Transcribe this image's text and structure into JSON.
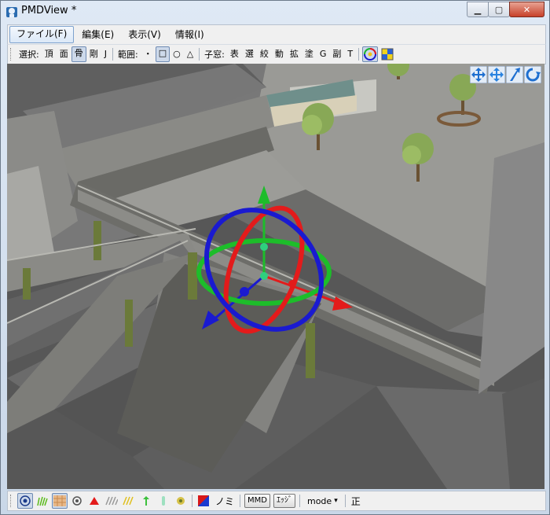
{
  "window": {
    "title": "PMDView *"
  },
  "menu": {
    "items": [
      "ファイル(F)",
      "編集(E)",
      "表示(V)",
      "情報(I)"
    ]
  },
  "toolbar": {
    "select_label": "選択:",
    "select_buttons": [
      "頂",
      "面",
      "骨",
      "剛",
      "J"
    ],
    "range_label": "範囲:",
    "range_buttons": [
      "・",
      "□",
      "○",
      "△"
    ],
    "child_label": "子窓:",
    "child_buttons": [
      "表",
      "選",
      "絞",
      "動",
      "拡",
      "塗",
      "G",
      "副",
      "T"
    ]
  },
  "viewport": {
    "controls": [
      "move-view-icon",
      "move-icon",
      "rotate-icon",
      "rotate-view-icon"
    ],
    "gizmo_colors": {
      "x": "#e31b1b",
      "y": "#1dbd2a",
      "z": "#1a1ad0"
    }
  },
  "statusbar": {
    "btn_mmd": "MMD",
    "btn_edge": "ｴｯｼﾞ",
    "mode_label": "mode",
    "mode_arrow": "▾",
    "text_nomi": "ノミ",
    "text_sei": "正"
  }
}
